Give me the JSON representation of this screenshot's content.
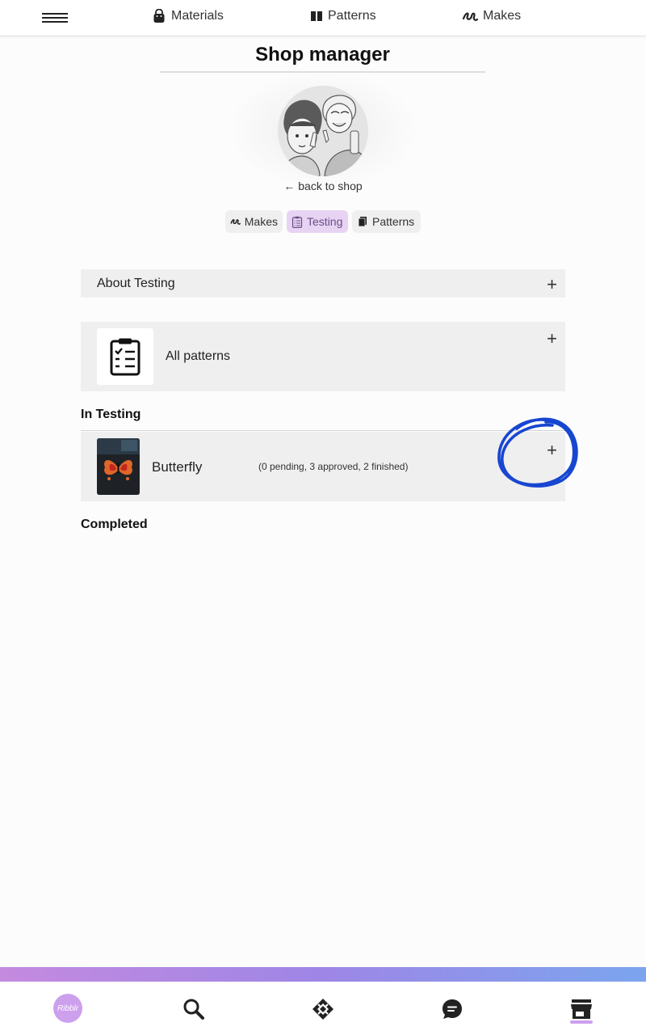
{
  "topbar": {
    "materials_label": "Materials",
    "patterns_label": "Patterns",
    "makes_label": "Makes"
  },
  "page": {
    "title": "Shop manager",
    "back_link": "← back to shop"
  },
  "tabs": [
    {
      "label": "Makes",
      "icon": "makes-icon",
      "active": false
    },
    {
      "label": "Testing",
      "icon": "clipboard-icon",
      "active": true
    },
    {
      "label": "Patterns",
      "icon": "book-icon",
      "active": false
    }
  ],
  "about": {
    "label": "About Testing",
    "toggle": "+"
  },
  "all_patterns": {
    "label": "All patterns",
    "toggle": "+"
  },
  "sections": {
    "in_testing": "In Testing",
    "completed": "Completed"
  },
  "testing_items": [
    {
      "name": "Butterfly",
      "status": "(0 pending, 3 approved, 2 finished)",
      "toggle": "+"
    }
  ],
  "bottom_nav": {
    "logo_text": "Ribblr",
    "items": [
      "home",
      "search",
      "patterns",
      "chat",
      "shop"
    ],
    "active": "shop"
  },
  "colors": {
    "accent": "#cda0ee",
    "active_tab_bg": "#e7d3f2",
    "panel_bg": "#efefef",
    "scribble": "#1746d1"
  }
}
